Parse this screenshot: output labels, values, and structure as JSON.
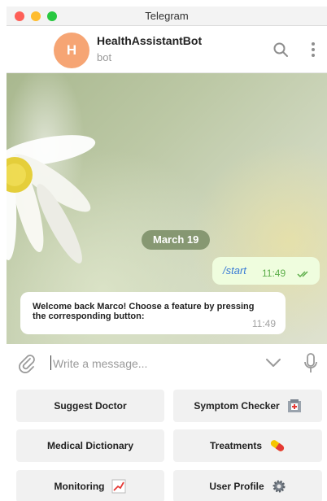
{
  "window": {
    "title": "Telegram"
  },
  "chat_header": {
    "avatar_letter": "H",
    "bot_name": "HealthAssistantBot",
    "status": "bot"
  },
  "messages": {
    "date": "March 19",
    "outgoing": {
      "text": "/start",
      "time": "11:49"
    },
    "incoming": {
      "text": "Welcome back Marco! Choose a feature by pressing the corresponding button:",
      "time": "11:49"
    }
  },
  "composer": {
    "placeholder": "Write a message..."
  },
  "keyboard": {
    "buttons": [
      {
        "label": "Suggest Doctor",
        "icon": ""
      },
      {
        "label": "Symptom Checker",
        "icon": "hospital-icon"
      },
      {
        "label": "Medical Dictionary",
        "icon": ""
      },
      {
        "label": "Treatments",
        "icon": "pill-icon"
      },
      {
        "label": "Monitoring",
        "icon": "chart-increasing-icon"
      },
      {
        "label": "User Profile",
        "icon": "gear-icon"
      }
    ]
  },
  "colors": {
    "avatar": "#f6a574",
    "outgoing_bubble": "#effdde",
    "link": "#3a7bd5",
    "read_check": "#5dae4a"
  }
}
